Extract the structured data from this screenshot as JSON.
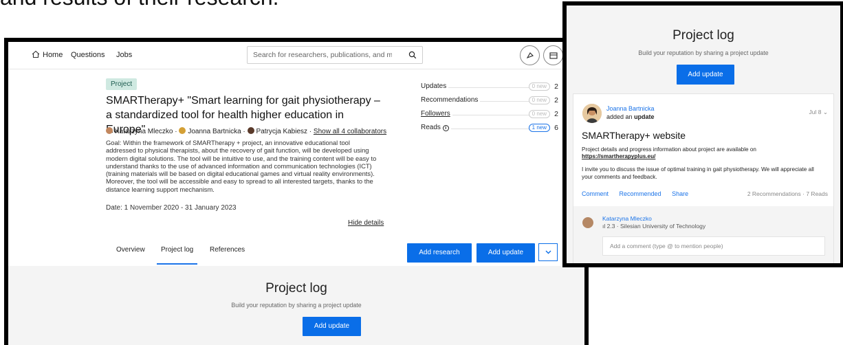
{
  "caption": "and results of their research.",
  "nav": {
    "home": "Home",
    "questions": "Questions",
    "jobs": "Jobs",
    "search_placeholder": "Search for researchers, publications, and more"
  },
  "project": {
    "badge": "Project",
    "title": "SMARTherapy+ \"Smart learning for gait physiotherapy – a standardized tool for health higher education in Europe\"",
    "authors": [
      "Katarzyna Mleczko",
      "Joanna Bartnicka",
      "Patrycja Kabiesz"
    ],
    "show_all": "Show all 4 collaborators",
    "goal": "Goal: Within the framework of SMARTherapy + project, an innovative educational tool addressed to physical therapists, about the recovery of gait function, will be developed using modern digital solutions. The tool will be intuitive to use, and the training content will be easy to understand thanks to the use of advanced information and communication technologies (ICT) (training materials will be based on digital educational games and virtual reality environments). Moreover, the tool will be accessible and easy to spread to all interested targets, thanks to the distance learning support mechanism.",
    "date": "Date: 1 November 2020 - 31 January 2023",
    "hide_details": "Hide details"
  },
  "stats": [
    {
      "label": "Updates",
      "pill": "0 new",
      "count": "2",
      "underline": false,
      "info": false,
      "active": false
    },
    {
      "label": "Recommendations",
      "pill": "0 new",
      "count": "2",
      "underline": false,
      "info": false,
      "active": false
    },
    {
      "label": "Followers",
      "pill": "0 new",
      "count": "2",
      "underline": true,
      "info": false,
      "active": false
    },
    {
      "label": "Reads",
      "pill": "1 new",
      "count": "6",
      "underline": false,
      "info": true,
      "active": true
    }
  ],
  "tabs": [
    "Overview",
    "Project log",
    "References"
  ],
  "buttons": {
    "add_research": "Add research",
    "add_update": "Add update"
  },
  "log": {
    "title": "Project log",
    "subtitle": "Build your reputation by sharing a project update",
    "add_update": "Add update"
  },
  "post": {
    "author": "Joanna Bartnicka",
    "action_prefix": "added an",
    "action_bold": "update",
    "date": "Jul 8",
    "title": "SMARTherapy+ website",
    "text1": "Project details and progress information about project are available on",
    "link": "https://smartherapyplus.eu/",
    "text2": "I invite you to discuss the issue of optimal training in gait physiotherapy. We will appreciate all your comments and feedback.",
    "actions": [
      "Comment",
      "Recommended",
      "Share"
    ],
    "counts": "2 Recommendations · 7 Reads"
  },
  "comment": {
    "author": "Katarzyna Mleczko",
    "meta": "2.3 · Silesian University of Technology",
    "placeholder": "Add a comment (type @ to mention people)"
  },
  "colors": {
    "accent": "#0a6ee8",
    "link": "#1a73e8",
    "badge_bg": "#cfe9e1",
    "panel_bg": "#f4f4f4"
  }
}
